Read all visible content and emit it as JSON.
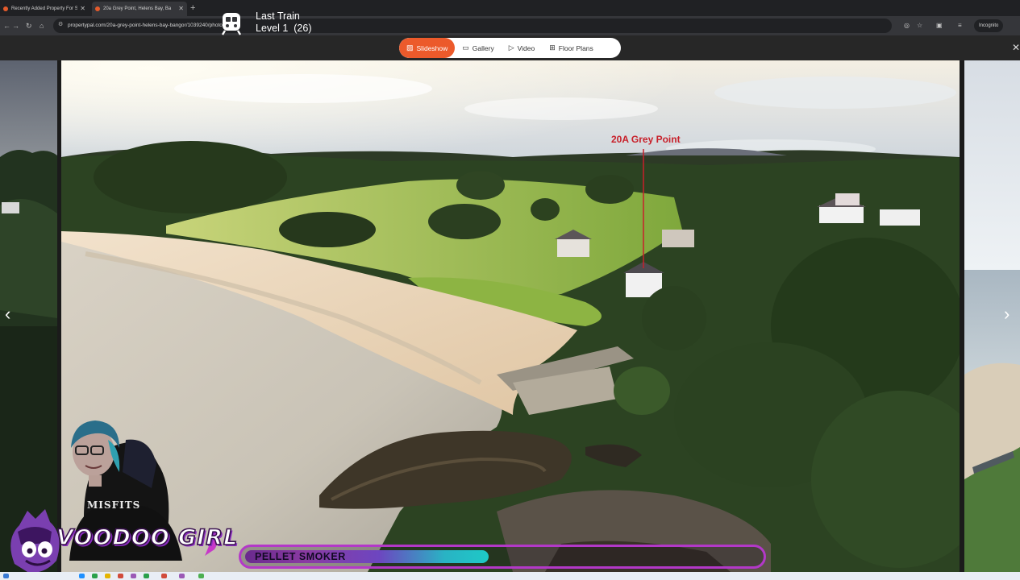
{
  "browser": {
    "tabs": [
      {
        "title": "Recently Added Property For S"
      },
      {
        "title": "20a Grey Point, Helens Bay, Ba"
      }
    ],
    "new_tab": "+",
    "url": "propertypal.com/20a-grey-point-helens-bay-bangor/1039240/photo",
    "incognito_label": "Incognito"
  },
  "overlay": {
    "train_title": "Last Train",
    "train_level": "Level 1  (26)"
  },
  "viewer": {
    "tabs": [
      {
        "label": "Slideshow",
        "icon": "image-icon",
        "active": true
      },
      {
        "label": "Gallery",
        "icon": "gallery-icon",
        "active": false
      },
      {
        "label": "Video",
        "icon": "video-icon",
        "active": false
      },
      {
        "label": "Floor Plans",
        "icon": "floorplan-icon",
        "active": false
      }
    ],
    "marker_label": "20A Grey Point",
    "prev_label": "‹",
    "next_label": "›",
    "close_label": "✕"
  },
  "stream": {
    "channel_logo": "VOODOO GIRL",
    "shirt_text": "MISFITS",
    "ticker_text": "PELLET SMOKER",
    "ticker_progress": 0.47
  },
  "colors": {
    "accent": "#ec5a2b",
    "marker": "#c8202a",
    "ticker_border": "#b338c8"
  }
}
